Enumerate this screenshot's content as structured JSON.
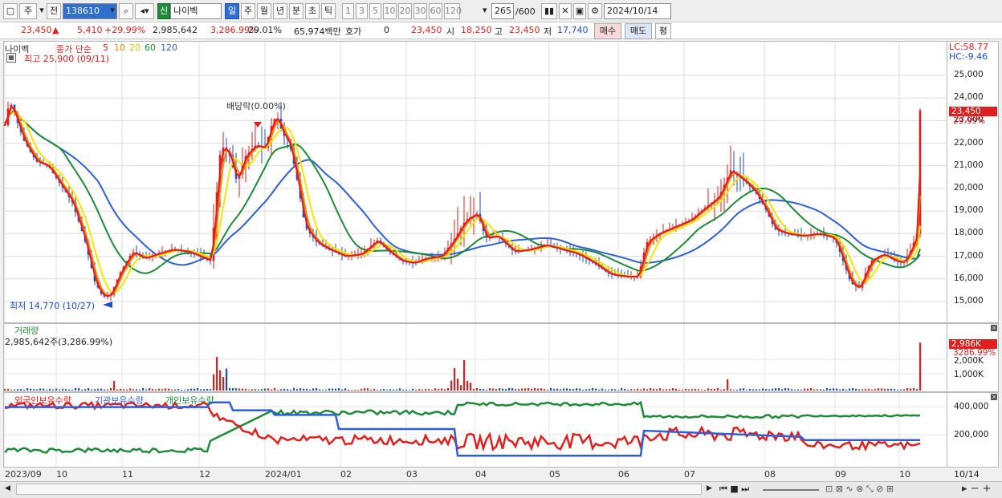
{
  "toolbar": {
    "period_label": "주",
    "prev_label": "전",
    "code": "138610",
    "market_badge": "신",
    "name": "나이벡",
    "periods": [
      "일",
      "주",
      "월",
      "년",
      "분",
      "초",
      "틱"
    ],
    "active_period": "일",
    "nums": [
      "1",
      "3",
      "5",
      "10",
      "20",
      "30",
      "60",
      "120"
    ],
    "count_value": "265",
    "count_total": "/600",
    "date": "2024/10/14"
  },
  "quote": {
    "price": "23,450",
    "change": "5,410",
    "change_pct": "+29.99%",
    "volume": "2,985,642",
    "volume_pct": "3,286.99%",
    "turnover": "29.01%",
    "amount": "65,974백만",
    "hoga_label": "호가",
    "hoga_value": "0",
    "cur": "23,450",
    "open_label": "시",
    "open": "18,250",
    "high_label": "고",
    "high": "23,450",
    "low_label": "저",
    "low": "17,740",
    "buy_label": "매수",
    "sell_label": "매도",
    "eval_label": "평"
  },
  "price_panel": {
    "name_tag": "나이벡",
    "ma_label": "종가 단순",
    "ma_periods": [
      "5",
      "10",
      "20",
      "60",
      "120"
    ],
    "ma_colors": [
      "#e0201e",
      "#f08a00",
      "#f5e600",
      "#1f8a3a",
      "#2f5fd8"
    ],
    "high_note": "최고 25,900 (09/11)",
    "low_note": "최저 14,770 (10/27)",
    "div_note": "배당락(0.00%)",
    "lc": "LC:58.77",
    "hc": "HC:-9.46",
    "last_price_tag": "23,450",
    "last_pct_tag": "29.99%",
    "y_ticks": [
      "25,000",
      "24,000",
      "23,000",
      "22,000",
      "21,000",
      "20,000",
      "19,000",
      "18,000",
      "17,000",
      "16,000",
      "15,000"
    ]
  },
  "volume_panel": {
    "title": "거래량",
    "value": "2,985,642주(3,286.99%)",
    "tag": "2,986K",
    "tag_pct": "3286.99%",
    "y_ticks": [
      "2,000K",
      "1,000K"
    ]
  },
  "holding_panel": {
    "series": [
      {
        "name": "외국인보유수량",
        "color": "#e0201e"
      },
      {
        "name": "기관보유수량",
        "color": "#2f5fd8"
      },
      {
        "name": "개인보유수량",
        "color": "#1f8a3a"
      }
    ],
    "y_ticks": [
      "400,000",
      "200,000"
    ]
  },
  "x_axis": [
    "2023/09",
    "10",
    "11",
    "12",
    "2024/01",
    "02",
    "03",
    "04",
    "05",
    "06",
    "07",
    "08",
    "09",
    "10"
  ],
  "x_axis_right": "10/14",
  "colors": {
    "up": "#e0201e",
    "down": "#1a4fc8",
    "ma5": "#e0201e",
    "ma10": "#f08a00",
    "ma20": "#f5e600",
    "ma60": "#1f8a3a",
    "ma120": "#2f5fd8"
  }
}
